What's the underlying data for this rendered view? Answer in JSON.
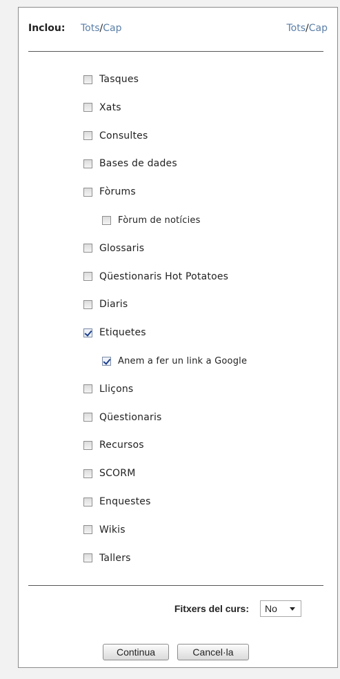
{
  "header": {
    "label": "Inclou:",
    "left_all": "Tots",
    "left_none": "Cap",
    "right_all": "Tots",
    "right_none": "Cap",
    "separator": "/"
  },
  "items": [
    {
      "label": "Tasques",
      "checked": false,
      "level": 0
    },
    {
      "label": "Xats",
      "checked": false,
      "level": 0
    },
    {
      "label": "Consultes",
      "checked": false,
      "level": 0
    },
    {
      "label": "Bases de dades",
      "checked": false,
      "level": 0
    },
    {
      "label": "Fòrums",
      "checked": false,
      "level": 0
    },
    {
      "label": "Fòrum de notícies",
      "checked": false,
      "level": 1
    },
    {
      "label": "Glossaris",
      "checked": false,
      "level": 0
    },
    {
      "label": "Qüestionaris Hot Potatoes",
      "checked": false,
      "level": 0
    },
    {
      "label": "Diaris",
      "checked": false,
      "level": 0
    },
    {
      "label": "Etiquetes",
      "checked": true,
      "level": 0
    },
    {
      "label": "Anem a fer un link a Google",
      "checked": true,
      "level": 1
    },
    {
      "label": "Lliçons",
      "checked": false,
      "level": 0
    },
    {
      "label": "Qüestionaris",
      "checked": false,
      "level": 0
    },
    {
      "label": "Recursos",
      "checked": false,
      "level": 0
    },
    {
      "label": "SCORM",
      "checked": false,
      "level": 0
    },
    {
      "label": "Enquestes",
      "checked": false,
      "level": 0
    },
    {
      "label": "Wikis",
      "checked": false,
      "level": 0
    },
    {
      "label": "Tallers",
      "checked": false,
      "level": 0
    }
  ],
  "course_files": {
    "label": "Fitxers del curs:",
    "selected": "No"
  },
  "buttons": {
    "continue": "Continua",
    "cancel": "Cancel·la"
  },
  "colors": {
    "link": "#5a7fa8",
    "check": "#1c3f8c"
  }
}
